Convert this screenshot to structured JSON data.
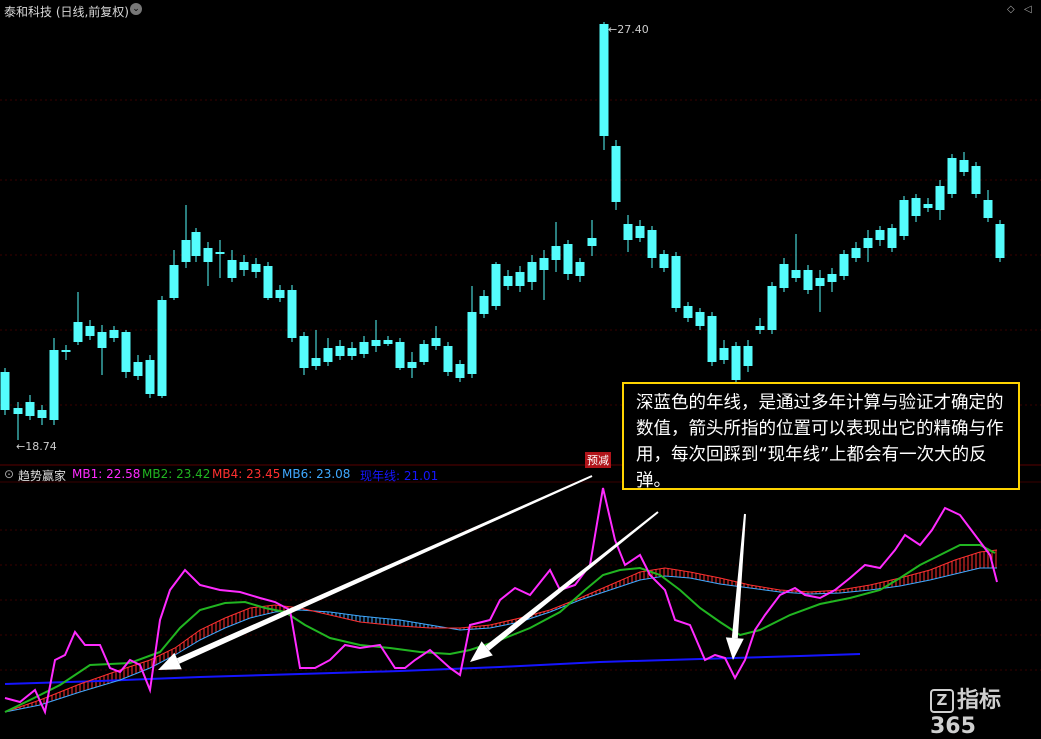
{
  "header": {
    "title": "泰和科技 (日线,前复权)",
    "dropdown_icon": "chevron-down-icon"
  },
  "price_labels": {
    "high": "27.40",
    "low": "18.74"
  },
  "badge": "预减",
  "indicator": {
    "name": "趋势赢家",
    "mb1": "MB1: 22.58",
    "mb2": "MB2: 23.42",
    "mb4": "MB4: 23.45",
    "mb6": "MB6: 23.08",
    "year_line": "现年线: 21.01",
    "colors": {
      "mb1": "#ff2bff",
      "mb2": "#21b521",
      "mb4": "#ff3030",
      "mb6": "#3fa9ff",
      "year_line": "#1515ff"
    }
  },
  "annotation": "深蓝色的年线，是通过多年计算与验证才确定的数值，箭头所指的位置可以表现出它的精确与作用，每次回踩到“现年线”上都会有一次大的反弹。",
  "watermark": "指标365",
  "chart_data": {
    "type": "candlestick",
    "price_range": [
      18.74,
      27.4
    ],
    "colors": {
      "up": "#ff3c3c",
      "down": "#54fcfc"
    }
  }
}
